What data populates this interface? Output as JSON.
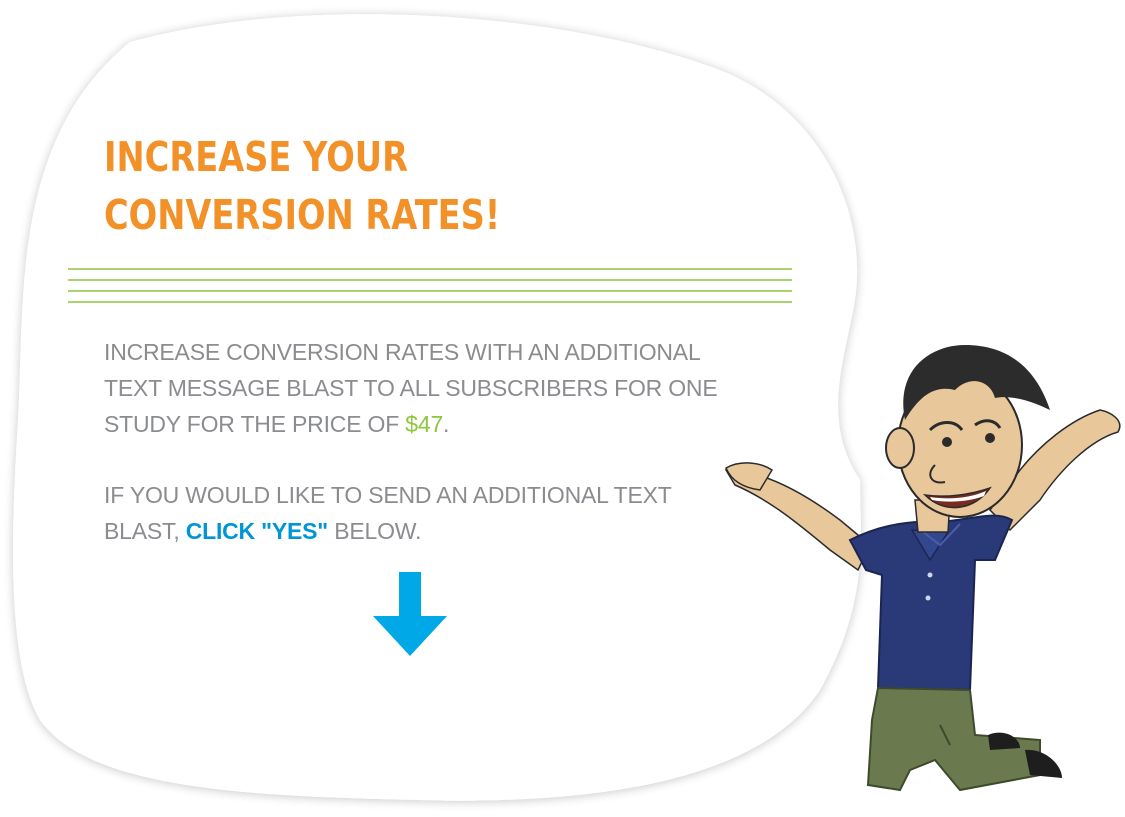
{
  "headline": {
    "line1": "INCREASE YOUR",
    "line2": "CONVERSION RATES!"
  },
  "paragraph1": {
    "text": "INCREASE CONVERSION RATES WITH AN ADDITIONAL TEXT MESSAGE BLAST TO ALL SUBSCRIBERS FOR ONE STUDY FOR THE PRICE OF ",
    "price": "$47",
    "end": "."
  },
  "paragraph2": {
    "text": "IF YOU WOULD LIKE TO SEND AN ADDITIONAL TEXT BLAST, ",
    "cta": "CLICK \"YES\"",
    "end": " BELOW."
  },
  "colors": {
    "headline": "#f39129",
    "body_text": "#8a8c90",
    "price": "#8cc63f",
    "cta": "#0096d6",
    "rules": "#a9d46d",
    "arrow": "#00a8e8"
  },
  "icons": {
    "arrow": "down-arrow-icon",
    "character": "cheering-man-illustration"
  }
}
